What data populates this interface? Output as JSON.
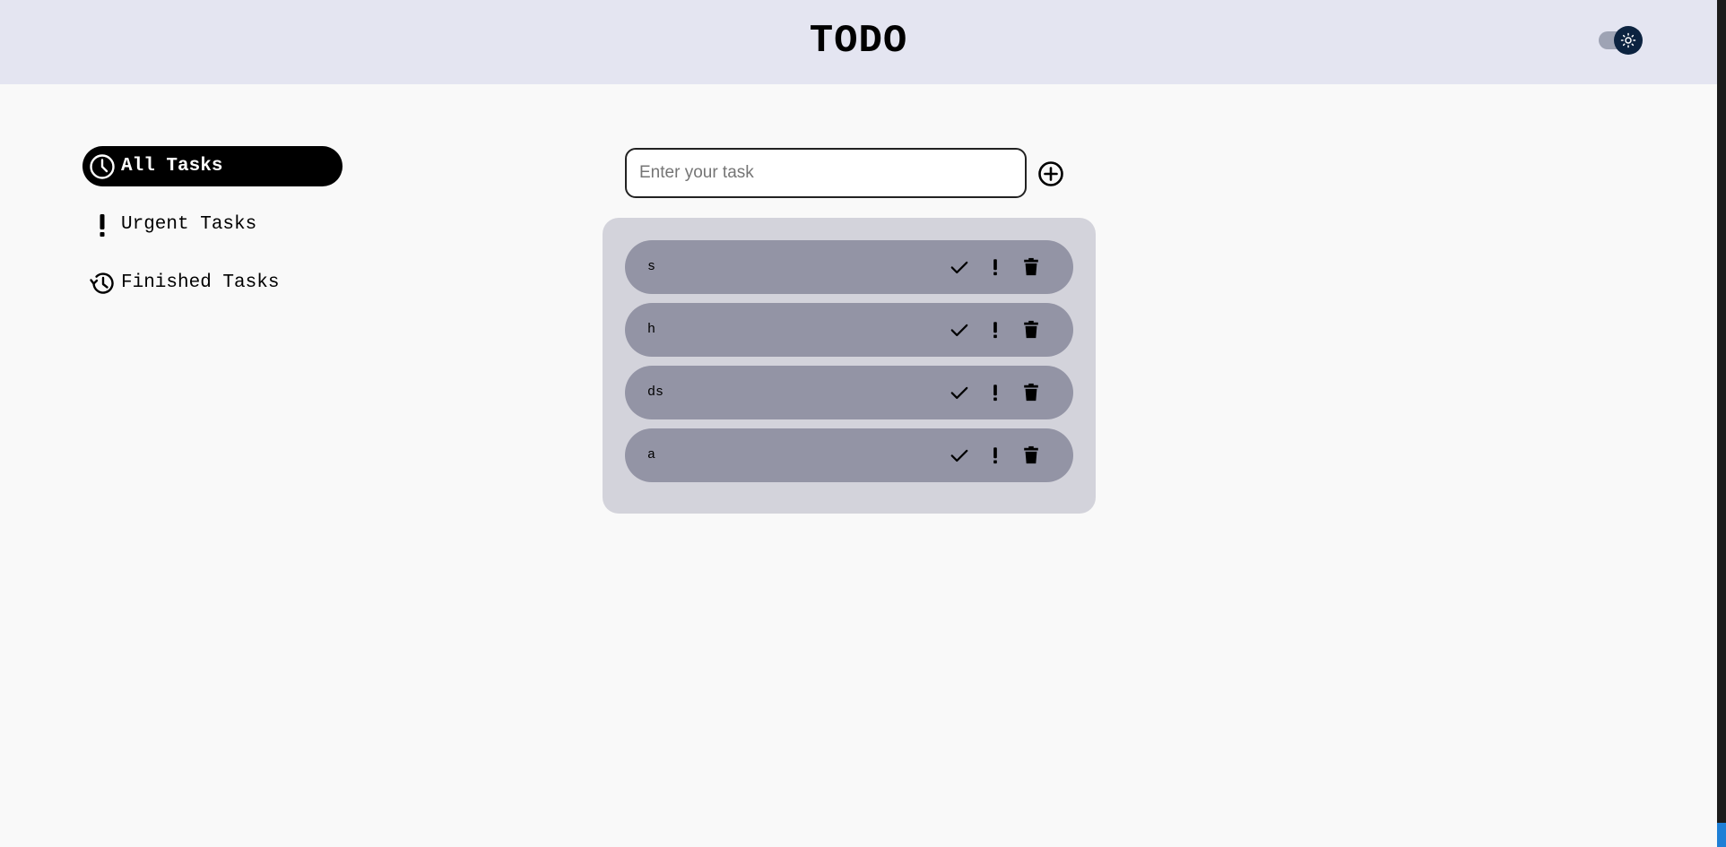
{
  "header": {
    "title": "TODO",
    "theme_toggle_icon": "sun-icon"
  },
  "sidebar": {
    "items": [
      {
        "label": "All Tasks",
        "icon": "clock-icon",
        "active": true
      },
      {
        "label": "Urgent Tasks",
        "icon": "exclamation-icon",
        "active": false
      },
      {
        "label": "Finished Tasks",
        "icon": "history-icon",
        "active": false
      }
    ]
  },
  "task_input": {
    "placeholder": "Enter your task",
    "value": "",
    "add_icon": "plus-circle-icon"
  },
  "tasks": [
    {
      "text": "s"
    },
    {
      "text": "h"
    },
    {
      "text": "ds"
    },
    {
      "text": "a"
    }
  ],
  "task_action_icons": [
    "check-icon",
    "exclamation-icon",
    "trash-icon"
  ],
  "colors": {
    "header_bg": "#e4e5f1",
    "page_bg": "#f9f9f9",
    "panel_bg": "#d3d3db",
    "task_bg": "#9394a5",
    "active_nav_bg": "#000000",
    "toggle_knob": "#0c2340"
  }
}
